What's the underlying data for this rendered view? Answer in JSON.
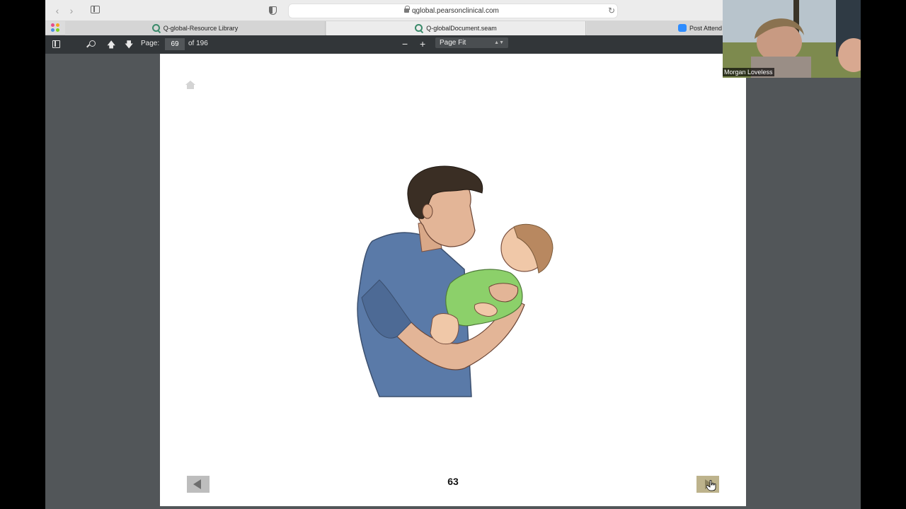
{
  "browser": {
    "url": "qglobal.pearsonclinical.com",
    "tabs": [
      {
        "label": "Q-global-Resource Library"
      },
      {
        "label": "Q-globalDocument.seam"
      },
      {
        "label": "Post Attend"
      }
    ]
  },
  "pdf_toolbar": {
    "page_label": "Page:",
    "page_value": "69",
    "page_total": "of 196",
    "zoom_value": "Page Fit",
    "zoom_options": [
      "Page Fit"
    ]
  },
  "document": {
    "page_number": "63",
    "illustration": "man-holding-baby"
  },
  "video": {
    "participant_name": "Morgan Loveless"
  },
  "colors": {
    "pdf_toolbar_bg": "#323639",
    "viewer_bg": "#525659",
    "shirt": "#5a7aa8",
    "onesie": "#8cd06a"
  }
}
